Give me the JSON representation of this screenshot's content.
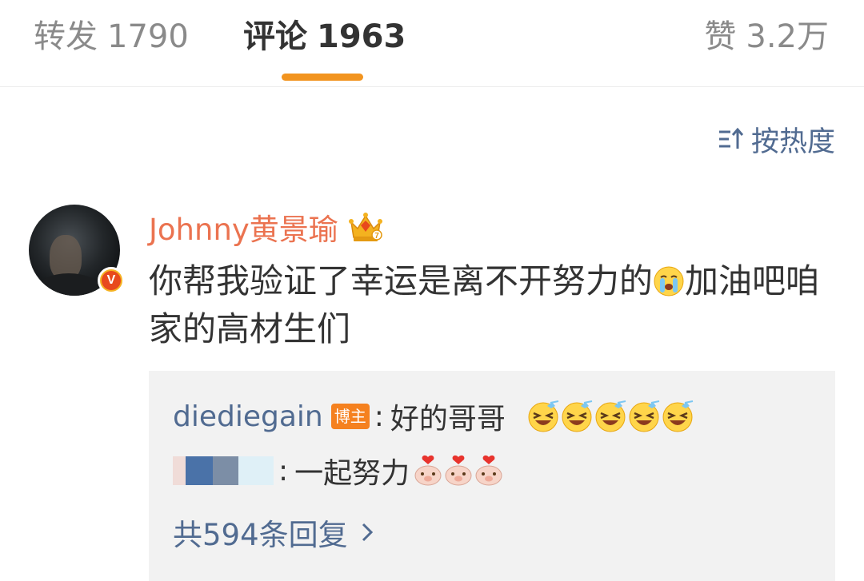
{
  "tabs": {
    "forward": {
      "label": "转发",
      "count": "1790"
    },
    "comment": {
      "label": "评论",
      "count": "1963"
    },
    "like": {
      "label": "赞",
      "count": "3.2万"
    }
  },
  "sort": {
    "label": "按热度",
    "icon": "sort-icon"
  },
  "comment": {
    "username": "Johnny黄景瑜",
    "badge_icon": "crown-icon",
    "verified_icon": "verified-v-icon",
    "text_before_emoji": "你帮我验证了幸运是离不开努力的",
    "emoji": "crying-emoji",
    "text_after_emoji": "加油吧咱家的高材生们"
  },
  "replies": [
    {
      "username": "diediegain",
      "badge": "博主",
      "separator": ":",
      "text": "好的哥哥",
      "emojis": [
        "laughing-tears-emoji",
        "laughing-tears-emoji",
        "laughing-tears-emoji",
        "laughing-tears-emoji",
        "laughing-tears-emoji"
      ]
    },
    {
      "username_blurred": true,
      "separator": ":",
      "text": "一起努力",
      "emojis": [
        "pig-heart-emoji",
        "pig-heart-emoji",
        "pig-heart-emoji"
      ]
    }
  ],
  "more_replies": {
    "label": "共594条回复",
    "icon": "chevron-right-icon"
  },
  "colors": {
    "accent": "#f2941f",
    "username": "#eb7350",
    "link": "#516b91",
    "text": "#333333",
    "muted": "#8a8a8a"
  }
}
